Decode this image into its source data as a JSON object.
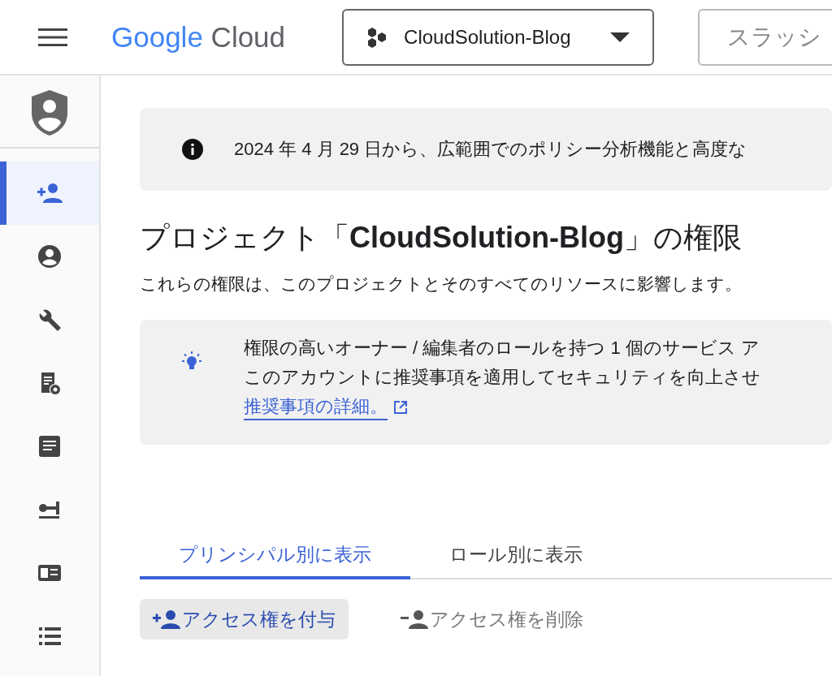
{
  "header": {
    "brand": {
      "word1": "Google",
      "word2": "Cloud"
    },
    "project": "CloudSolution-Blog",
    "search": {
      "placeholder": "スラッシ"
    }
  },
  "sidebar": {
    "items": [
      {
        "selected": true
      },
      {
        "selected": false
      },
      {
        "selected": false
      },
      {
        "selected": false
      },
      {
        "selected": false
      },
      {
        "selected": false
      },
      {
        "selected": false
      },
      {
        "selected": false
      }
    ]
  },
  "notice": "2024 年 4 月 29 日から、広範囲でのポリシー分析機能と高度な",
  "title": "プロジェクト「**CloudSolution-Blog**」の権限",
  "subtitle": "これらの権限は、このプロジェクトとそのすべてのリソースに影響します。",
  "recommendation": {
    "lines": [
      "権限の高いオーナー / 編集者のロールを持つ 1 個のサービス ア",
      "このアカウントに推奨事項を適用してセキュリティを向上させ"
    ],
    "link": "推奨事項の詳細。"
  },
  "tabs": [
    {
      "label": "プリンシパル別に表示",
      "selected": true
    },
    {
      "label": "ロール別に表示",
      "selected": false
    }
  ],
  "actions": [
    {
      "label": "アクセス権を付与",
      "disabled": false
    },
    {
      "label": "アクセス権を削除",
      "disabled": true
    }
  ]
}
